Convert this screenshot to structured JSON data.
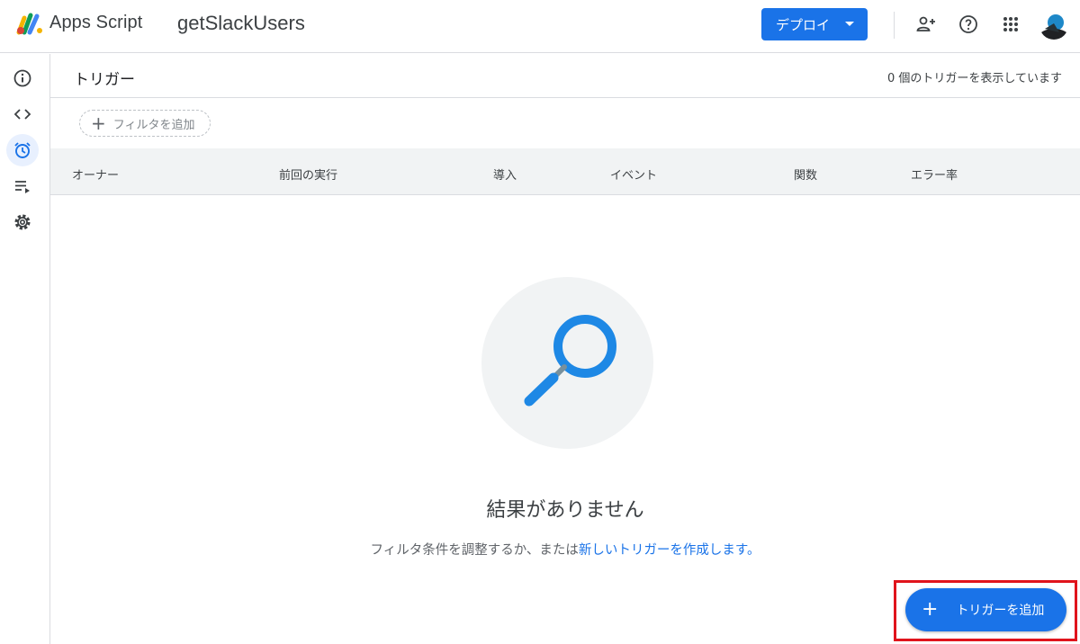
{
  "header": {
    "app_name": "Apps Script",
    "project_name": "getSlackUsers",
    "deploy_label": "デプロイ"
  },
  "icons": {
    "logo": "apps-script-logo",
    "share": "person-add-icon",
    "help": "help-icon",
    "apps": "apps-grid-icon",
    "avatar": "account-avatar",
    "rail": [
      "info-icon",
      "code-icon",
      "alarm-clock-icon",
      "executions-icon",
      "settings-gear-icon"
    ]
  },
  "triggers": {
    "title": "トリガー",
    "count_text": "0 個のトリガーを表示しています",
    "filter_label": "フィルタを追加",
    "columns": [
      "オーナー",
      "前回の実行",
      "導入",
      "イベント",
      "関数",
      "エラー率"
    ]
  },
  "empty_state": {
    "title": "結果がありません",
    "sub_prefix": "フィルタ条件を調整するか、または",
    "sub_link": "新しいトリガーを作成します。"
  },
  "fab": {
    "label": "トリガーを追加"
  },
  "colors": {
    "accent": "#1a73e8",
    "highlight": "#e0141c",
    "active_rail_bg": "#e8f0fe",
    "magnifier": "#1e88e5"
  }
}
